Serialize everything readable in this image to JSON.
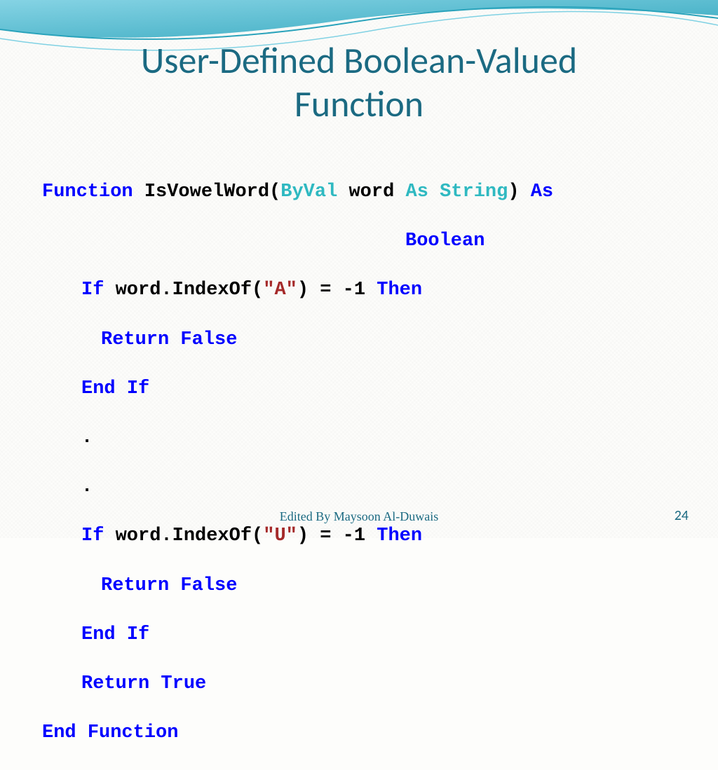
{
  "title_line1": "User-Defined Boolean-Valued",
  "title_line2": "Function",
  "code": {
    "l1": {
      "kw_function": "Function",
      "name": " IsVowelWord(",
      "byval": "ByVal",
      "param": " word ",
      "askw": "As",
      "sp": " ",
      "type": "String",
      "close": ")",
      "askw2": " As"
    },
    "l2": {
      "boolean": "Boolean"
    },
    "l3": {
      "ifkw": "If",
      "mid": " word.IndexOf(",
      "str": "\"A\"",
      "tail": ") = -1 ",
      "then": "Then"
    },
    "l4": {
      "ret": "Return",
      "sp": " ",
      "val": "False"
    },
    "l5": {
      "endif": "End",
      "sp": " ",
      "ifk": "If"
    },
    "l6": {
      "dot": "."
    },
    "l7": {
      "dot": "."
    },
    "l8": {
      "ifkw": "If",
      "mid": " word.IndexOf(",
      "str": "\"U\"",
      "tail": ") = -1 ",
      "then": "Then"
    },
    "l9": {
      "ret": "Return",
      "sp": " ",
      "val": "False"
    },
    "l10": {
      "endif": "End",
      "sp": " ",
      "ifk": "If"
    },
    "l11": {
      "ret": "Return",
      "sp": " ",
      "val": "True"
    },
    "l12": {
      "end": "End",
      "sp": " ",
      "fn": "Function"
    }
  },
  "footer": "Edited By Maysoon Al-Duwais",
  "page_number": "24"
}
